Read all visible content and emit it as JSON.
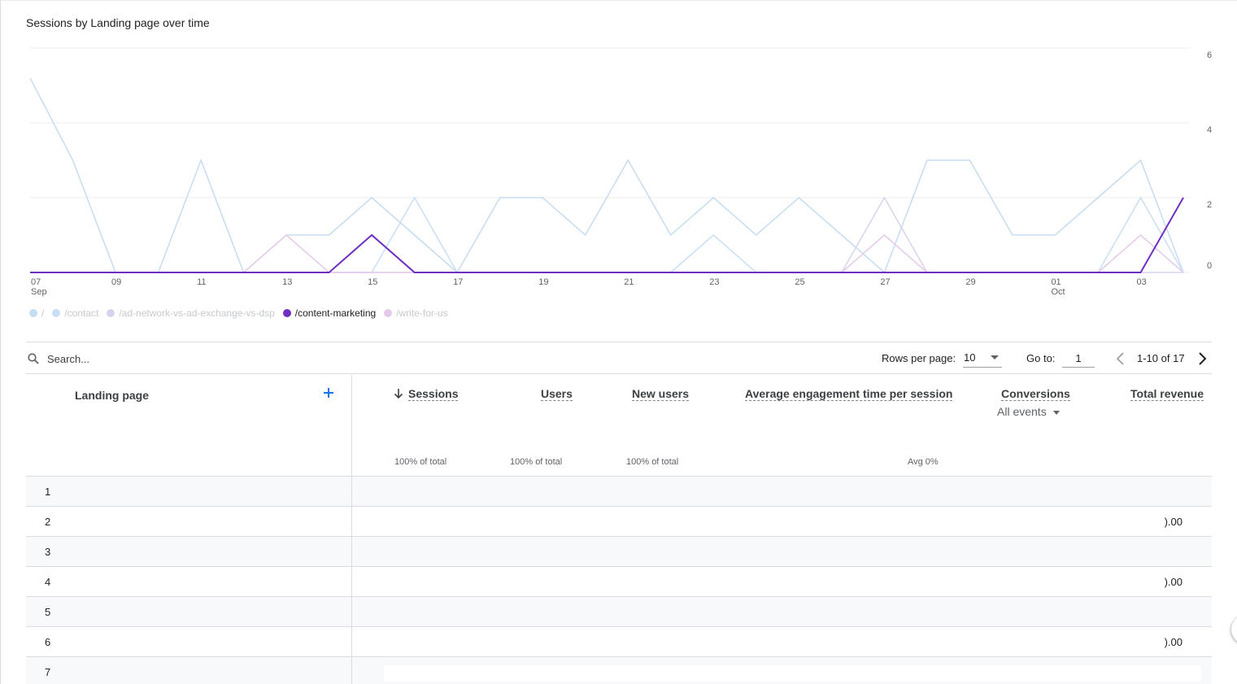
{
  "chart_section": {
    "title": "Sessions by Landing page over time"
  },
  "chart_data": {
    "type": "line",
    "title": "Sessions by Landing page over time",
    "x": [
      "2023-09-07",
      "2023-09-08",
      "2023-09-09",
      "2023-09-10",
      "2023-09-11",
      "2023-09-12",
      "2023-09-13",
      "2023-09-14",
      "2023-09-15",
      "2023-09-16",
      "2023-09-17",
      "2023-09-18",
      "2023-09-19",
      "2023-09-20",
      "2023-09-21",
      "2023-09-22",
      "2023-09-23",
      "2023-09-24",
      "2023-09-25",
      "2023-09-26",
      "2023-09-27",
      "2023-09-28",
      "2023-09-29",
      "2023-09-30",
      "2023-10-01",
      "2023-10-02",
      "2023-10-03",
      "2023-10-04"
    ],
    "x_tick_labels": [
      {
        "day": "07",
        "month": "Sep"
      },
      {
        "day": "09",
        "month": ""
      },
      {
        "day": "11",
        "month": ""
      },
      {
        "day": "13",
        "month": ""
      },
      {
        "day": "15",
        "month": ""
      },
      {
        "day": "17",
        "month": ""
      },
      {
        "day": "19",
        "month": ""
      },
      {
        "day": "21",
        "month": ""
      },
      {
        "day": "23",
        "month": ""
      },
      {
        "day": "25",
        "month": ""
      },
      {
        "day": "27",
        "month": ""
      },
      {
        "day": "29",
        "month": ""
      },
      {
        "day": "01",
        "month": "Oct"
      },
      {
        "day": "03",
        "month": ""
      }
    ],
    "y_ticks": [
      "0",
      "2",
      "4",
      "6"
    ],
    "ylim": [
      0,
      6
    ],
    "grid": true,
    "legend_position": "bottom-left",
    "series": [
      {
        "name": "/",
        "color": "#c6dcf0",
        "active": false,
        "values": [
          5.2,
          3.0,
          0,
          0,
          3.0,
          0,
          1.0,
          1.0,
          2.0,
          1.0,
          0,
          2.0,
          2.0,
          1.0,
          3.0,
          1.0,
          2.0,
          1.0,
          2.0,
          1.0,
          0,
          3.0,
          3.0,
          1.0,
          1.0,
          2.0,
          3.0,
          0
        ]
      },
      {
        "name": "/contact",
        "color": "#c9dff5",
        "active": false,
        "values": [
          0,
          0,
          0,
          0,
          0,
          0,
          0,
          0,
          0,
          2.0,
          0,
          0,
          0,
          0,
          0,
          0,
          1.0,
          0,
          0,
          0,
          0,
          0,
          0,
          0,
          0,
          0,
          2.0,
          0
        ]
      },
      {
        "name": "/ad-network-vs-ad-exchange-vs-dsp",
        "color": "#d9d2ee",
        "active": false,
        "values": [
          0,
          0,
          0,
          0,
          0,
          0,
          0,
          0,
          0,
          0,
          0,
          0,
          0,
          0,
          0,
          0,
          0,
          0,
          0,
          0,
          2.0,
          0,
          0,
          0,
          0,
          0,
          0,
          0
        ]
      },
      {
        "name": "/content-marketing",
        "color": "#6f2fc0",
        "active": true,
        "values": [
          0,
          0,
          0,
          0,
          0,
          0,
          0,
          0,
          1.0,
          0,
          0,
          0,
          0,
          0,
          0,
          0,
          0,
          0,
          0,
          0,
          0,
          0,
          0,
          0,
          0,
          0,
          0,
          2.0
        ]
      },
      {
        "name": "/write-for-us",
        "color": "#e4cbe9",
        "active": false,
        "values": [
          0,
          0,
          0,
          0,
          0,
          0,
          1.0,
          0,
          0,
          0,
          0,
          0,
          0,
          0,
          0,
          0,
          0,
          0,
          0,
          0,
          1.0,
          0,
          0,
          0,
          0,
          0,
          1.0,
          0
        ]
      }
    ]
  },
  "toolbar": {
    "search_placeholder": "Search...",
    "rows_per_page_label": "Rows per page:",
    "rows_per_page_value": "10",
    "goto_label": "Go to:",
    "goto_value": "1",
    "page_range": "1-10 of 17"
  },
  "table": {
    "dimension_header": "Landing page",
    "metrics": [
      {
        "label": "Sessions",
        "total": "100% of total"
      },
      {
        "label": "Users",
        "total": "100% of total"
      },
      {
        "label": "New users",
        "total": "100% of total"
      },
      {
        "label": "Average engagement time per session",
        "total": "Avg 0%"
      },
      {
        "label": "Conversions",
        "total": ""
      },
      {
        "label": "Total revenue",
        "total": ""
      }
    ],
    "conversions_filter": "All events",
    "rows": [
      {
        "num": "1",
        "value": ""
      },
      {
        "num": "2",
        "value": ").00"
      },
      {
        "num": "3",
        "value": ""
      },
      {
        "num": "4",
        "value": ").00"
      },
      {
        "num": "5",
        "value": ""
      },
      {
        "num": "6",
        "value": ").00"
      },
      {
        "num": "7",
        "value": ""
      }
    ]
  },
  "colors": {
    "accent": "#1a73e8",
    "active_series": "#6f2fc0",
    "gridline": "#ececec",
    "divider": "#dadce0"
  }
}
